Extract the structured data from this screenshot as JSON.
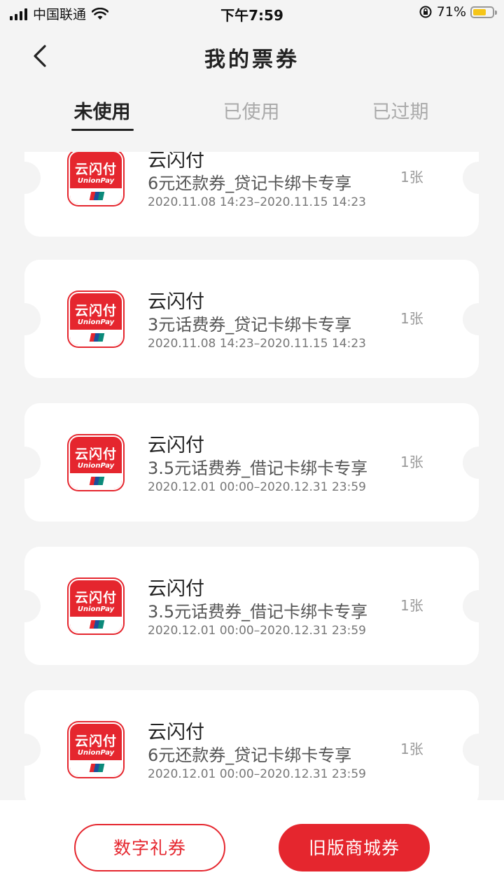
{
  "status_bar": {
    "carrier": "中国联通",
    "time": "下午7:59",
    "battery_percent": "71%",
    "battery_level": 0.71
  },
  "header": {
    "title": "我的票券"
  },
  "tabs": [
    {
      "label": "未使用",
      "active": true
    },
    {
      "label": "已使用",
      "active": false
    },
    {
      "label": "已过期",
      "active": false
    }
  ],
  "coupons": [
    {
      "issuer": "云闪付",
      "desc": "6元还款券_贷记卡绑卡专享",
      "period": "2020.11.08 14:23–2020.11.15 14:23",
      "count": "1张"
    },
    {
      "issuer": "云闪付",
      "desc": "3元话费券_贷记卡绑卡专享",
      "period": "2020.11.08 14:23–2020.11.15 14:23",
      "count": "1张"
    },
    {
      "issuer": "云闪付",
      "desc": "3.5元话费券_借记卡绑卡专享",
      "period": "2020.12.01 00:00–2020.12.31 23:59",
      "count": "1张"
    },
    {
      "issuer": "云闪付",
      "desc": "3.5元话费券_借记卡绑卡专享",
      "period": "2020.12.01 00:00–2020.12.31 23:59",
      "count": "1张"
    },
    {
      "issuer": "云闪付",
      "desc": "6元还款券_贷记卡绑卡专享",
      "period": "2020.12.01 00:00–2020.12.31 23:59",
      "count": "1张"
    }
  ],
  "logo": {
    "cn": "云闪付",
    "en": "UnionPay"
  },
  "bottom": {
    "digital_gift_label": "数字礼券",
    "old_mall_label": "旧版商城券"
  },
  "colors": {
    "accent": "#e5262e",
    "background": "#f4f4f4"
  }
}
